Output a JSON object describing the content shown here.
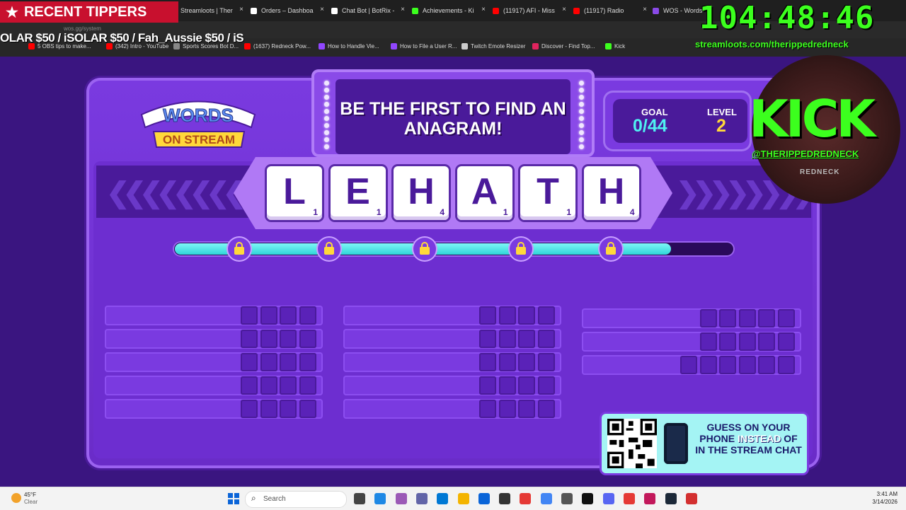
{
  "overlay": {
    "tippers_label": "RECENT TIPPERS",
    "tippers_ticker": "OLAR $50 / iSOLAR $50 / Fah_Aussie $50 /      iS",
    "timer": "104:48:46",
    "loots_url": "streamloots.com/therippedredneck",
    "kick_logo": "KICK",
    "kick_handle": "@THERIPPEDREDNECK",
    "kick_sub": "REDNECK"
  },
  "browser": {
    "tabs": [
      {
        "label": "Streamloots | Ther",
        "color": "#e0245e"
      },
      {
        "label": "Orders – Dashboa",
        "color": "#ffffff"
      },
      {
        "label": "Chat Bot | BotRix -",
        "color": "#ffffff"
      },
      {
        "label": "Achievements - Ki",
        "color": "#3cff1e"
      },
      {
        "label": "(11917) AFI - Miss",
        "color": "#ff0000"
      },
      {
        "label": "(11917) Radio",
        "color": "#ff0000"
      },
      {
        "label": "WOS - Words",
        "color": "#8a4ae8"
      }
    ],
    "address": "wos.gg/system",
    "bookmarks": [
      {
        "label": "5 OBS tips to make...",
        "color": "#ff0000"
      },
      {
        "label": "(342) Intro - YouTube",
        "color": "#ff0000"
      },
      {
        "label": "Sports Scores Bot D...",
        "color": "#888888"
      },
      {
        "label": "(1637) Redneck Pow...",
        "color": "#ff0000"
      },
      {
        "label": "How to Handle Vie...",
        "color": "#9146ff"
      },
      {
        "label": "How to File a User R...",
        "color": "#9146ff"
      },
      {
        "label": "Twitch Emote Resizer",
        "color": "#cccccc"
      },
      {
        "label": "Discover - Find Top...",
        "color": "#e0245e"
      },
      {
        "label": "Kick",
        "color": "#3cff1e"
      }
    ]
  },
  "game": {
    "logo_top": "WORDS",
    "logo_bottom": "ON STREAM",
    "headline": "BE THE FIRST TO FIND AN ANAGRAM!",
    "goal_label": "GOAL",
    "goal_value": "0/44",
    "level_label": "LEVEL",
    "level_value": "2",
    "tiles": [
      {
        "letter": "L",
        "points": "1"
      },
      {
        "letter": "E",
        "points": "1"
      },
      {
        "letter": "H",
        "points": "4"
      },
      {
        "letter": "A",
        "points": "1"
      },
      {
        "letter": "T",
        "points": "1"
      },
      {
        "letter": "H",
        "points": "4"
      }
    ],
    "progress_fraction": 0.89,
    "lock_count": 5,
    "word_columns": [
      {
        "slots": [
          4,
          4,
          4,
          4,
          4
        ]
      },
      {
        "slots": [
          4,
          4,
          4,
          4,
          4
        ]
      },
      {
        "slots": [
          5,
          5,
          6
        ]
      }
    ],
    "qr_text_a": "GUESS ON YOUR PHONE ",
    "qr_text_highlight": "INSTEAD",
    "qr_text_b": " OF IN THE STREAM CHAT"
  },
  "colors": {
    "accent_green": "#3cff1e",
    "board_purple": "#7a3ae0",
    "progress_cyan": "#2fd4d8",
    "lock_yellow": "#ffd83a"
  },
  "taskbar": {
    "weather_temp": "45°F",
    "weather_cond": "Clear",
    "search_label": "Search",
    "time": "3:41 AM",
    "date": "3/14/2026"
  }
}
